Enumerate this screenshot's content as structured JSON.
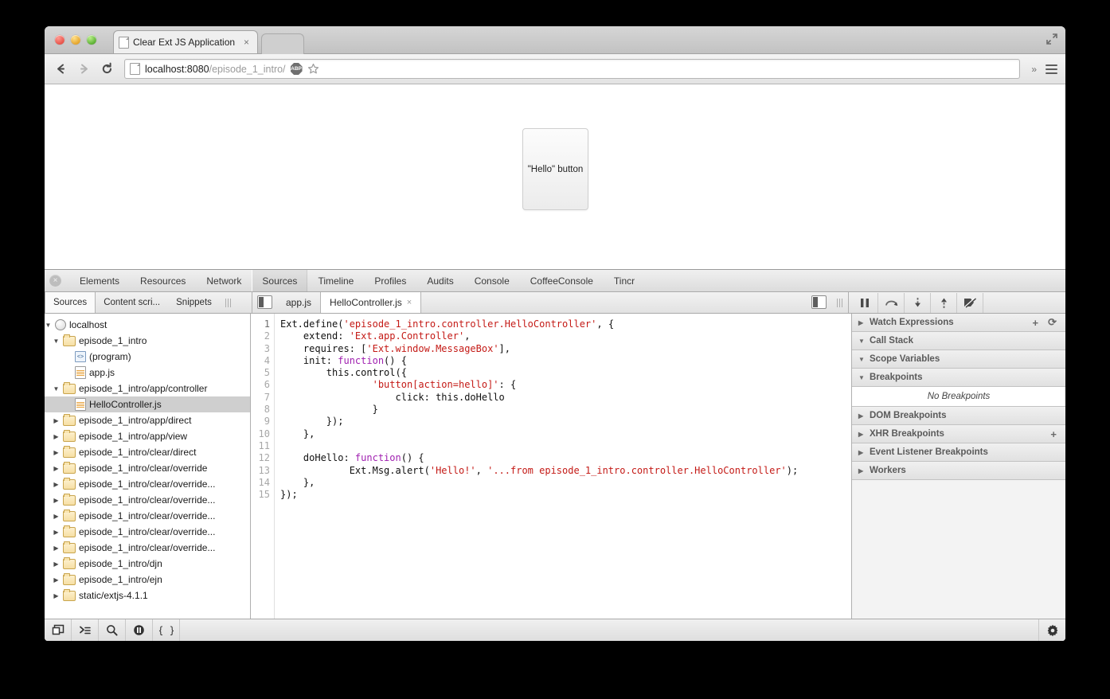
{
  "browser": {
    "tab": {
      "title": "Clear Ext JS Application",
      "close": "×",
      "icon": "page-icon"
    },
    "nav": {
      "back": "←",
      "forward": "→",
      "reload": "⟳"
    },
    "omnibox": {
      "url_host": "localhost:8080",
      "url_path": "/episode_1_intro/",
      "abp_label": "ABP",
      "star": "☆"
    },
    "menu": {
      "overflow": "»"
    },
    "maximize": "⤢"
  },
  "page": {
    "hello_button_label": "\"Hello\" button"
  },
  "devtools": {
    "close_label": "×",
    "tabs": [
      {
        "label": "Elements",
        "active": false
      },
      {
        "label": "Resources",
        "active": false
      },
      {
        "label": "Network",
        "active": false
      },
      {
        "label": "Sources",
        "active": true
      },
      {
        "label": "Timeline",
        "active": false
      },
      {
        "label": "Profiles",
        "active": false
      },
      {
        "label": "Audits",
        "active": false
      },
      {
        "label": "Console",
        "active": false
      },
      {
        "label": "CoffeeConsole",
        "active": false
      },
      {
        "label": "Tincr",
        "active": false
      }
    ],
    "sidebar_tabs": [
      {
        "label": "Sources",
        "active": true
      },
      {
        "label": "Content scri...",
        "active": false
      },
      {
        "label": "Snippets",
        "active": false
      }
    ],
    "file_tabs": [
      {
        "label": "app.js",
        "active": false,
        "close": ""
      },
      {
        "label": "HelloController.js",
        "active": true,
        "close": "×"
      }
    ],
    "debug_buttons": [
      {
        "name": "pause-button"
      },
      {
        "name": "step-over-button"
      },
      {
        "name": "step-into-button"
      },
      {
        "name": "step-out-button"
      },
      {
        "name": "deactivate-breakpoints-button"
      }
    ],
    "tree": [
      {
        "label": "localhost",
        "icon": "globe",
        "indent": 0,
        "tri": "▼",
        "selected": false
      },
      {
        "label": "episode_1_intro",
        "icon": "folder",
        "indent": 1,
        "tri": "▼",
        "selected": false
      },
      {
        "label": "(program)",
        "icon": "program",
        "indent": 2,
        "tri": "",
        "selected": false
      },
      {
        "label": "app.js",
        "icon": "jsfile",
        "indent": 2,
        "tri": "",
        "selected": false
      },
      {
        "label": "episode_1_intro/app/controller",
        "icon": "folder",
        "indent": 1,
        "tri": "▼",
        "selected": false
      },
      {
        "label": "HelloController.js",
        "icon": "jsfile",
        "indent": 2,
        "tri": "",
        "selected": true
      },
      {
        "label": "episode_1_intro/app/direct",
        "icon": "folder",
        "indent": 1,
        "tri": "▶",
        "selected": false
      },
      {
        "label": "episode_1_intro/app/view",
        "icon": "folder",
        "indent": 1,
        "tri": "▶",
        "selected": false
      },
      {
        "label": "episode_1_intro/clear/direct",
        "icon": "folder",
        "indent": 1,
        "tri": "▶",
        "selected": false
      },
      {
        "label": "episode_1_intro/clear/override",
        "icon": "folder",
        "indent": 1,
        "tri": "▶",
        "selected": false
      },
      {
        "label": "episode_1_intro/clear/override...",
        "icon": "folder",
        "indent": 1,
        "tri": "▶",
        "selected": false
      },
      {
        "label": "episode_1_intro/clear/override...",
        "icon": "folder",
        "indent": 1,
        "tri": "▶",
        "selected": false
      },
      {
        "label": "episode_1_intro/clear/override...",
        "icon": "folder",
        "indent": 1,
        "tri": "▶",
        "selected": false
      },
      {
        "label": "episode_1_intro/clear/override...",
        "icon": "folder",
        "indent": 1,
        "tri": "▶",
        "selected": false
      },
      {
        "label": "episode_1_intro/clear/override...",
        "icon": "folder",
        "indent": 1,
        "tri": "▶",
        "selected": false
      },
      {
        "label": "episode_1_intro/djn",
        "icon": "folder",
        "indent": 1,
        "tri": "▶",
        "selected": false
      },
      {
        "label": "episode_1_intro/ejn",
        "icon": "folder",
        "indent": 1,
        "tri": "▶",
        "selected": false
      },
      {
        "label": "static/extjs-4.1.1",
        "icon": "folder",
        "indent": 1,
        "tri": "▶",
        "selected": false
      }
    ],
    "code": {
      "line_numbers": [
        "1",
        "2",
        "3",
        "4",
        "5",
        "6",
        "7",
        "8",
        "9",
        "10",
        "11",
        "12",
        "13",
        "14",
        "15"
      ],
      "lines": [
        "Ext.define('episode_1_intro.controller.HelloController', {",
        "    extend: 'Ext.app.Controller',",
        "    requires: ['Ext.window.MessageBox'],",
        "    init: function() {",
        "        this.control({",
        "                'button[action=hello]': {",
        "                    click: this.doHello",
        "                }",
        "        });",
        "    },",
        "",
        "    doHello: function() {",
        "            Ext.Msg.alert('Hello!', '...from episode_1_intro.controller.HelloController');",
        "    },",
        "});"
      ]
    },
    "panels": [
      {
        "label": "Watch Expressions",
        "arrow": "▶",
        "actions": [
          "+",
          "⟳"
        ]
      },
      {
        "label": "Call Stack",
        "arrow": "▼",
        "actions": []
      },
      {
        "label": "Scope Variables",
        "arrow": "▼",
        "actions": []
      },
      {
        "label": "Breakpoints",
        "arrow": "▼",
        "actions": []
      }
    ],
    "no_breakpoints": "No Breakpoints",
    "panels_after": [
      {
        "label": "DOM Breakpoints",
        "arrow": "▶",
        "actions": []
      },
      {
        "label": "XHR Breakpoints",
        "arrow": "▶",
        "actions": [
          "+"
        ]
      },
      {
        "label": "Event Listener Breakpoints",
        "arrow": "▶",
        "actions": []
      },
      {
        "label": "Workers",
        "arrow": "▶",
        "actions": []
      }
    ],
    "status_buttons": [
      {
        "name": "dock-side-button"
      },
      {
        "name": "show-console-button"
      },
      {
        "name": "search-button"
      },
      {
        "name": "pause-on-exceptions-button"
      },
      {
        "name": "pretty-print-button"
      }
    ],
    "settings_button": "gear-icon"
  }
}
